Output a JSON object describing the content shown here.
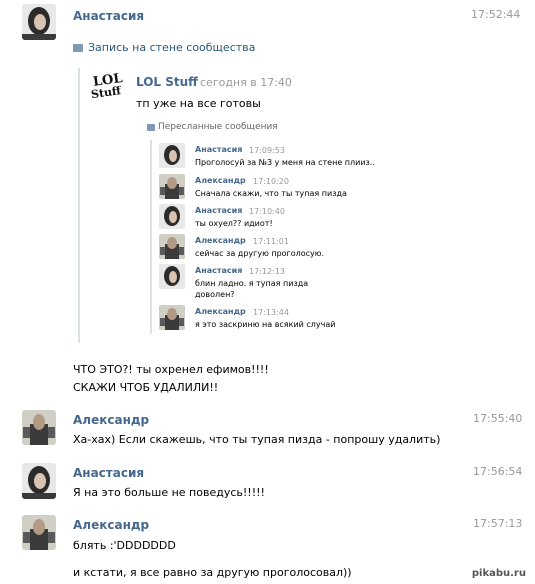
{
  "messages_top": {
    "author": "Анастасия",
    "time": "17:52:44",
    "wall_post_link": "Запись на стене сообщества"
  },
  "repost": {
    "group_name": "LOL Stuff",
    "group_time": "сегодня в 17:40",
    "logo_text_1": "LOL",
    "logo_text_2": "Stuff",
    "text": "тп уже на все готовы",
    "forwarded_label": "Пересланные сообщения",
    "forwarded": [
      {
        "author": "Анастасия",
        "time": "17:09:53",
        "lines": [
          "Проголосуй за №3 у меня на стене плииз.."
        ]
      },
      {
        "author": "Александр",
        "time": "17:10:20",
        "lines": [
          "Сначала скажи, что ты тупая пизда"
        ]
      },
      {
        "author": "Анастасия",
        "time": "17:10:40",
        "lines": [
          "ты охуел?? идиот!"
        ]
      },
      {
        "author": "Александр",
        "time": "17:11:01",
        "lines": [
          "сейчас за другую проголосую."
        ]
      },
      {
        "author": "Анастасия",
        "time": "17:12:13",
        "lines": [
          "блин ладно. я тупая пизда",
          "доволен?"
        ]
      },
      {
        "author": "Александр",
        "time": "17:13:44",
        "lines": [
          "я это заскриню на всякий случай"
        ]
      }
    ]
  },
  "after_repost": {
    "line1": "ЧТО ЭТО?! ты охренел ефимов!!!!",
    "line2": "СКАЖИ ЧТОБ УДАЛИЛИ!!"
  },
  "messages": [
    {
      "author": "Александр",
      "time": "17:55:40",
      "lines": [
        "Ха-хах) Если скажешь, что ты тупая пизда - попрошу удалить)"
      ]
    },
    {
      "author": "Анастасия",
      "time": "17:56:54",
      "lines": [
        "Я на это больше не поведусь!!!!!"
      ]
    },
    {
      "author": "Александр",
      "time": "17:57:13",
      "lines": [
        "блять :'DDDDDDD",
        "и кстати, я все равно за другую проголосовал))"
      ]
    }
  ],
  "watermark": "pikabu.ru",
  "colors": {
    "name": "#45688e",
    "time": "#999999",
    "link": "#2b587a",
    "divider": "#dae1e8"
  }
}
